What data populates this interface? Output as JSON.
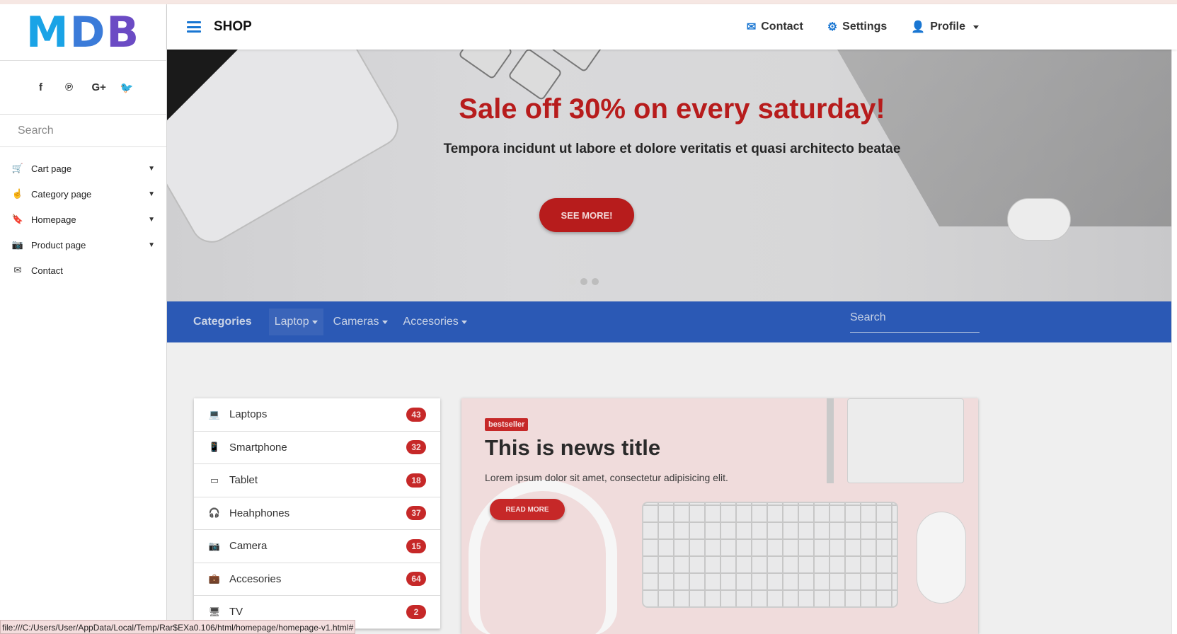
{
  "logo": {
    "m": "M",
    "d": "D",
    "b": "B"
  },
  "social": [
    {
      "name": "facebook-icon",
      "glyph": "f"
    },
    {
      "name": "pinterest-icon",
      "glyph": "℗"
    },
    {
      "name": "google-plus-icon",
      "glyph": "G+"
    },
    {
      "name": "twitter-icon",
      "glyph": "🐦"
    }
  ],
  "sidebar": {
    "search_placeholder": "Search",
    "items": [
      {
        "label": "Cart page",
        "icon": "🛒"
      },
      {
        "label": "Category page",
        "icon": "☝"
      },
      {
        "label": "Homepage",
        "icon": "🔖"
      },
      {
        "label": "Product page",
        "icon": "📷"
      },
      {
        "label": "Contact",
        "icon": "✉"
      }
    ]
  },
  "header": {
    "title": "SHOP",
    "nav": [
      {
        "label": "Contact",
        "icon": "✉"
      },
      {
        "label": "Settings",
        "icon": "⚙"
      },
      {
        "label": "Profile",
        "icon": "👤"
      }
    ]
  },
  "hero": {
    "title": "Sale off 30% on every saturday!",
    "subtitle": "Tempora incidunt ut labore et dolore veritatis et quasi architecto beatae",
    "button": "SEE MORE!"
  },
  "catbar": {
    "title": "Categories",
    "items": [
      "Laptop",
      "Cameras",
      "Accesories"
    ],
    "search_placeholder": "Search"
  },
  "categories": [
    {
      "label": "Laptops",
      "count": "43",
      "icon": "💻"
    },
    {
      "label": "Smartphone",
      "count": "32",
      "icon": "📱"
    },
    {
      "label": "Tablet",
      "count": "18",
      "icon": "▭"
    },
    {
      "label": "Heahphones",
      "count": "37",
      "icon": "🎧"
    },
    {
      "label": "Camera",
      "count": "15",
      "icon": "📷"
    },
    {
      "label": "Accesories",
      "count": "64",
      "icon": "💼"
    },
    {
      "label": "TV",
      "count": "2",
      "icon": "🖥"
    }
  ],
  "news": {
    "badge": "bestseller",
    "title": "This is news title",
    "text": "Lorem ipsum dolor sit amet, consectetur adipisicing elit.",
    "button": "READ MORE"
  },
  "status_url": "file:///C:/Users/User/AppData/Local/Temp/Rar$EXa0.106/html/homepage/homepage-v1.html#",
  "colors": {
    "accent_red": "#b71c1c",
    "navbar_blue": "#2b59b5",
    "header_icon_blue": "#1976d2"
  }
}
